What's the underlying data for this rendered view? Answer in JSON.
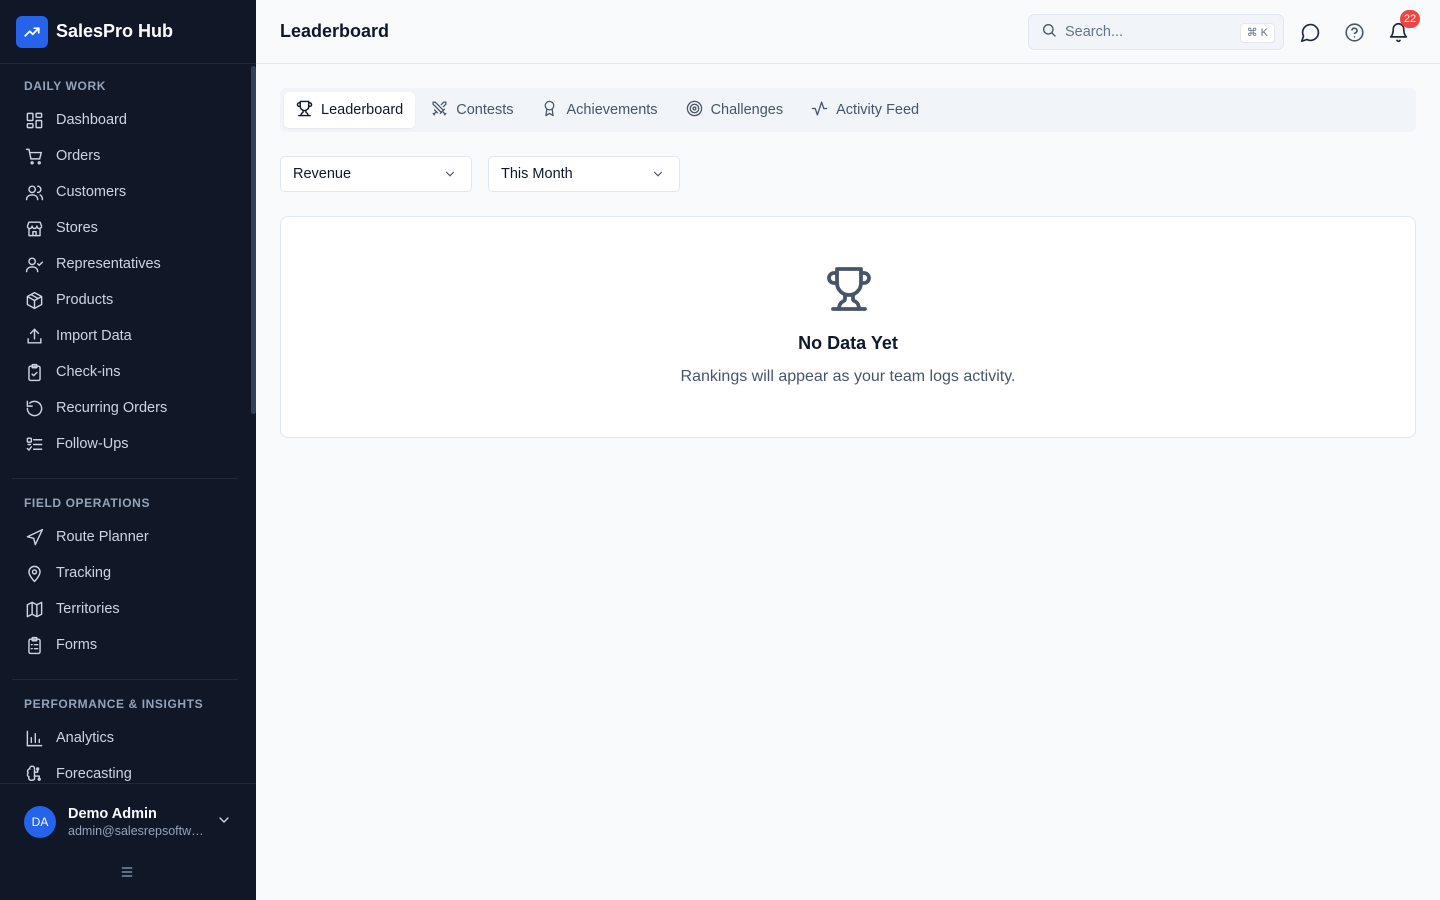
{
  "app": {
    "name": "SalesPro Hub"
  },
  "sidebar": {
    "sections": [
      {
        "title": "DAILY WORK",
        "items": [
          {
            "label": "Dashboard",
            "icon": "dashboard-icon"
          },
          {
            "label": "Orders",
            "icon": "cart-icon"
          },
          {
            "label": "Customers",
            "icon": "users-icon"
          },
          {
            "label": "Stores",
            "icon": "store-icon"
          },
          {
            "label": "Representatives",
            "icon": "user-check-icon"
          },
          {
            "label": "Products",
            "icon": "package-icon"
          },
          {
            "label": "Import Data",
            "icon": "upload-icon"
          },
          {
            "label": "Check-ins",
            "icon": "clipboard-check-icon"
          },
          {
            "label": "Recurring Orders",
            "icon": "refresh-icon"
          },
          {
            "label": "Follow-Ups",
            "icon": "list-check-icon"
          }
        ]
      },
      {
        "title": "FIELD OPERATIONS",
        "items": [
          {
            "label": "Route Planner",
            "icon": "navigation-icon"
          },
          {
            "label": "Tracking",
            "icon": "map-pin-icon"
          },
          {
            "label": "Territories",
            "icon": "map-icon"
          },
          {
            "label": "Forms",
            "icon": "clipboard-list-icon"
          }
        ]
      },
      {
        "title": "PERFORMANCE & INSIGHTS",
        "items": [
          {
            "label": "Analytics",
            "icon": "bar-chart-icon"
          },
          {
            "label": "Forecasting",
            "icon": "brain-icon"
          }
        ]
      }
    ]
  },
  "user": {
    "initials": "DA",
    "name": "Demo Admin",
    "email": "admin@salesrepsoftware.com"
  },
  "header": {
    "title": "Leaderboard",
    "search_placeholder": "Search...",
    "search_shortcut": "⌘ K",
    "notification_count": "22"
  },
  "tabs": [
    {
      "label": "Leaderboard",
      "icon": "trophy-icon",
      "active": true
    },
    {
      "label": "Contests",
      "icon": "swords-icon",
      "active": false
    },
    {
      "label": "Achievements",
      "icon": "award-icon",
      "active": false
    },
    {
      "label": "Challenges",
      "icon": "target-icon",
      "active": false
    },
    {
      "label": "Activity Feed",
      "icon": "activity-icon",
      "active": false
    }
  ],
  "filters": {
    "metric": "Revenue",
    "period": "This Month"
  },
  "empty_state": {
    "title": "No Data Yet",
    "text": "Rankings will appear as your team logs activity.",
    "icon": "trophy-icon"
  },
  "colors": {
    "sidebar_bg": "#101828",
    "accent": "#2563eb",
    "badge": "#ef4444"
  }
}
